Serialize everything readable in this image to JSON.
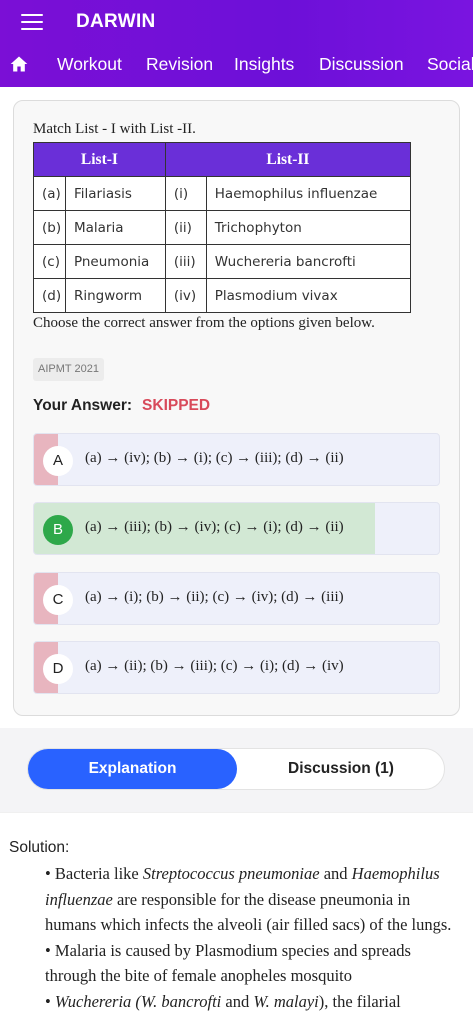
{
  "header": {
    "brand": "DARWIN",
    "nav": [
      "Workout",
      "Revision",
      "Insights",
      "Discussion",
      "Social"
    ]
  },
  "question": {
    "prompt": "Match List - I with List -II.",
    "table": {
      "headers": [
        "List-I",
        "List-II"
      ],
      "rows": [
        [
          "(a)",
          "Filariasis",
          "(i)",
          "Haemophilus influenzae"
        ],
        [
          "(b)",
          "Malaria",
          "(ii)",
          "Trichophyton"
        ],
        [
          "(c)",
          "Pneumonia",
          "(iii)",
          "Wuchereria bancrofti"
        ],
        [
          "(d)",
          "Ringworm",
          "(iv)",
          "Plasmodium vivax"
        ]
      ]
    },
    "after": "Choose the correct answer from the options given below.",
    "tag": "AIPMT 2021"
  },
  "answer": {
    "label": "Your Answer:",
    "value": "SKIPPED"
  },
  "options": [
    {
      "letter": "A",
      "text": "(a) → (iv); (b) → (i); (c) → (iii); (d) → (ii)"
    },
    {
      "letter": "B",
      "text": "(a) → (iii); (b) → (iv); (c) → (i); (d) → (ii)"
    },
    {
      "letter": "C",
      "text": "(a) → (i); (b) → (ii); (c) → (iv); (d) → (iii)"
    },
    {
      "letter": "D",
      "text": "(a) → (ii); (b) → (iii); (c) → (i); (d) → (iv)"
    }
  ],
  "tabs": {
    "explanation": "Explanation",
    "discussion": "Discussion (1)"
  },
  "solution": {
    "title": "Solution:",
    "b1_pre": "• Bacteria like ",
    "b1_it1": "Streptococcus pneumoniae",
    "b1_mid": " and ",
    "b1_it2": "Haemophilus influenzae",
    "b1_post": " are responsible for the disease pneumonia in humans which infects the alveoli (air filled sacs) of the lungs.",
    "b2": "• Malaria is caused by Plasmodium species and spreads through the bite of female anopheles mosquito",
    "b3_pre": "• ",
    "b3_it": "Wuchereria (W. bancrofti",
    "b3_mid": " and ",
    "b3_it2": "W. malayi",
    "b3_post": "), the filarial"
  },
  "colors": {
    "header": "#6d10d8",
    "table_header": "#6a2fd8",
    "skipped": "#d84a5a",
    "correct": "#2ea84a",
    "active_tab": "#2962ff"
  }
}
